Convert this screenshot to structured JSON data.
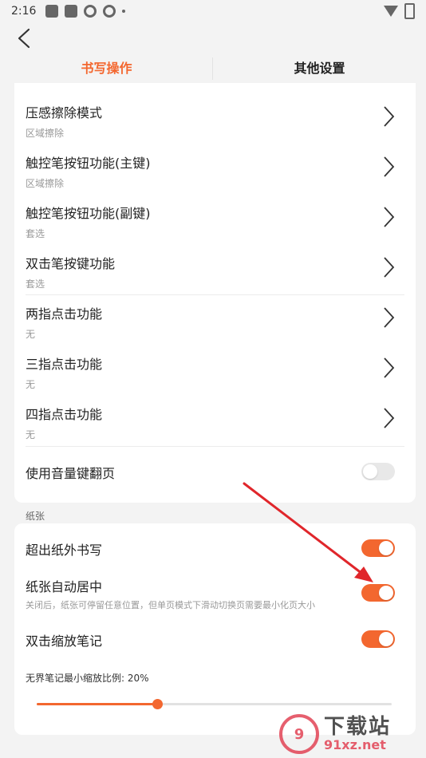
{
  "status": {
    "time": "2:16"
  },
  "tabs": [
    {
      "label": "书写操作",
      "active": true
    },
    {
      "label": "其他设置",
      "active": false
    }
  ],
  "card1": {
    "rows": [
      {
        "title": "压感擦除模式",
        "sub": "区域擦除"
      },
      {
        "title": "触控笔按钮功能(主键)",
        "sub": "区域擦除"
      },
      {
        "title": "触控笔按钮功能(副键)",
        "sub": "套选"
      },
      {
        "title": "双击笔按键功能",
        "sub": "套选"
      },
      {
        "title": "两指点击功能",
        "sub": "无"
      },
      {
        "title": "三指点击功能",
        "sub": "无"
      },
      {
        "title": "四指点击功能",
        "sub": "无"
      }
    ],
    "volume_toggle": {
      "title": "使用音量键翻页",
      "on": false
    }
  },
  "paper_section": {
    "label": "纸张",
    "items": [
      {
        "title": "超出纸外书写",
        "on": true
      },
      {
        "title": "纸张自动居中",
        "sub": "关闭后，纸张可停留任意位置，但单页模式下滑动切换页需要最小化页大小",
        "on": true
      },
      {
        "title": "双击缩放笔记",
        "on": true
      }
    ],
    "slider": {
      "label": "无界笔记最小缩放比例: 20%",
      "fraction": 0.34
    }
  },
  "watermark": {
    "logo": "9",
    "top": "下载站",
    "bottom": "91xz.net"
  },
  "colors": {
    "accent": "#f3672f",
    "arrow": "#e0262b"
  }
}
